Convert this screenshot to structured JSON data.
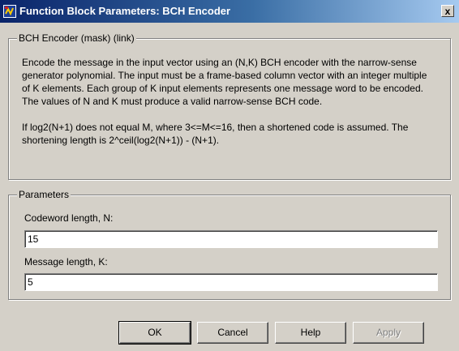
{
  "window": {
    "title": "Function Block Parameters: BCH Encoder",
    "close_label": "x"
  },
  "mask_group": {
    "legend": "BCH Encoder (mask) (link)",
    "paragraphs": [
      "Encode the message in the input vector using an (N,K) BCH encoder with the narrow-sense generator polynomial.  The input must be a frame-based column vector with an integer multiple of K elements.  Each group of K input elements represents one message word to be encoded.  The values of N and K must produce a valid narrow-sense BCH code.",
      "If log2(N+1) does not equal M, where 3<=M<=16, then a shortened code is assumed. The shortening length is 2^ceil(log2(N+1)) - (N+1)."
    ]
  },
  "parameters": {
    "legend": "Parameters",
    "codeword_label": "Codeword length, N:",
    "codeword_value": "15",
    "message_label": "Message length, K:",
    "message_value": "5"
  },
  "buttons": {
    "ok": "OK",
    "cancel": "Cancel",
    "help": "Help",
    "apply": "Apply"
  },
  "icons": {
    "app": "simulink-block-icon",
    "close": "close-icon"
  }
}
